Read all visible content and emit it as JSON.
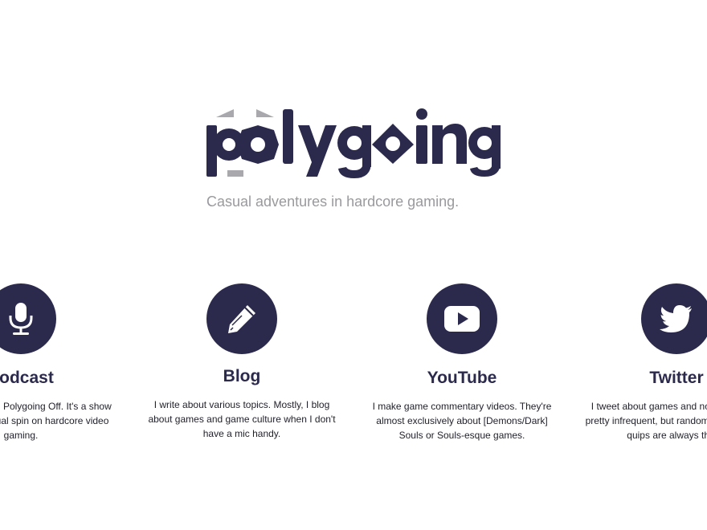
{
  "brand": {
    "logo_text": "polygoing",
    "tagline": "Casual adventures in hardcore gaming.",
    "primary_color": "#2b2a4c",
    "accent_gray": "#a8a8ad"
  },
  "cards": [
    {
      "icon": "microphone-icon",
      "title": "Podcast",
      "description": "A podcast called Polygoing Off. It's a show that puts a casual spin on hardcore video gaming."
    },
    {
      "icon": "pencil-icon",
      "title": "Blog",
      "description": "I write about various topics. Mostly, I blog about games and game culture when I don't have a mic handy."
    },
    {
      "icon": "youtube-icon",
      "title": "YouTube",
      "description": "I make game commentary videos. They're almost exclusively about [Demons/Dark] Souls or Souls-esque games."
    },
    {
      "icon": "twitter-icon",
      "title": "Twitter",
      "description": "I tweet about games and not games. It's pretty infrequent, but random thoughts and quips are always there."
    }
  ]
}
